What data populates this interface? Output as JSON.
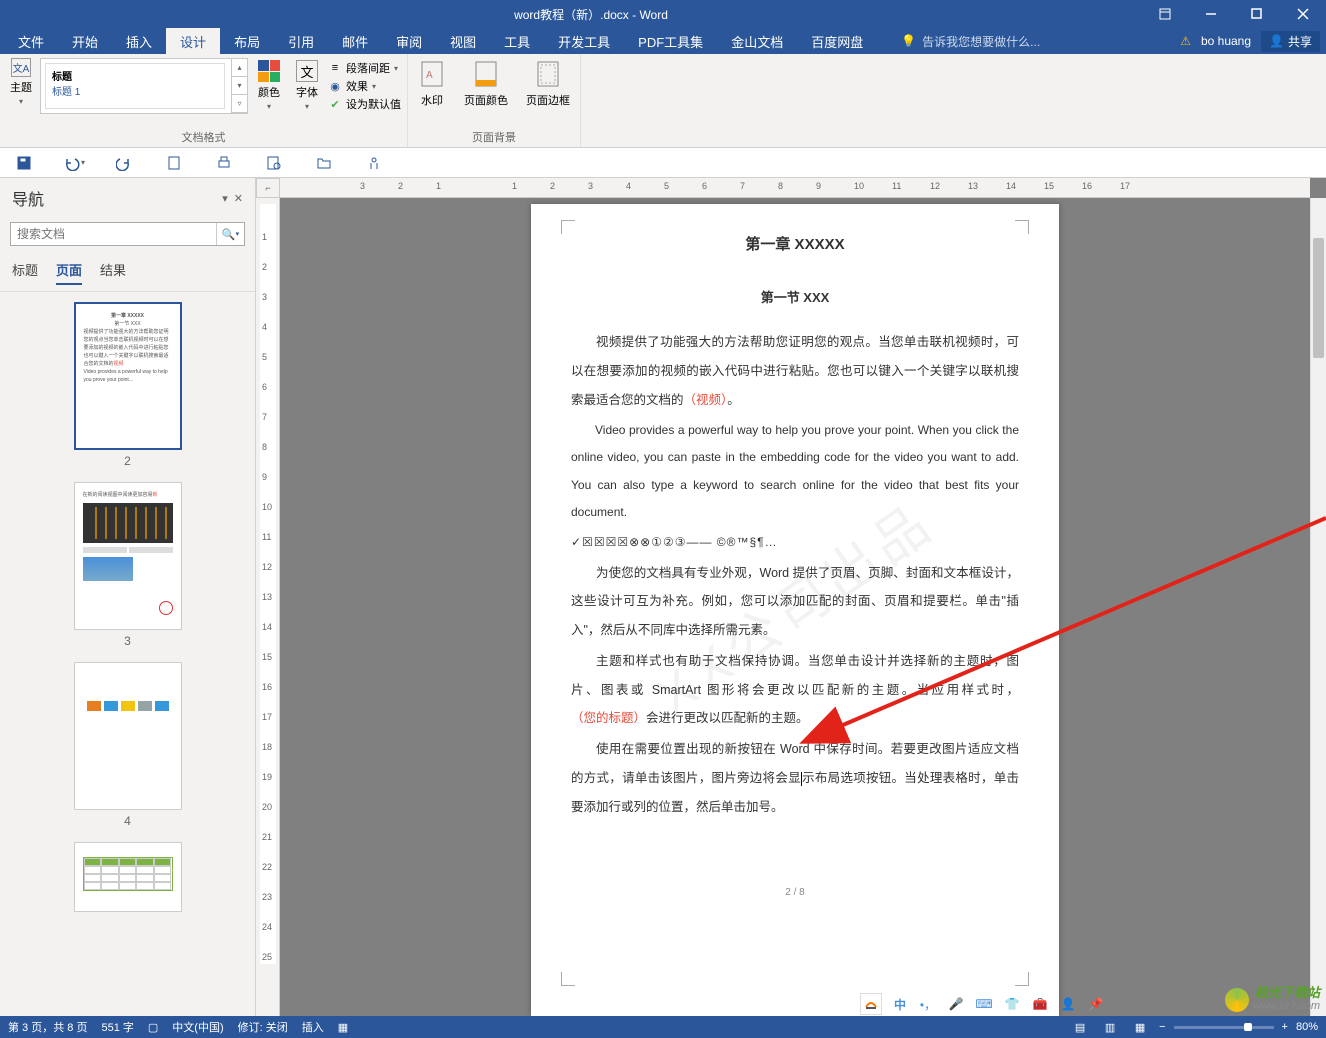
{
  "titlebar": {
    "title": "word教程（新）.docx - Word"
  },
  "account": {
    "warn_icon": "⚠",
    "name": "bo huang",
    "share": "共享"
  },
  "ribbon": {
    "tabs": [
      "文件",
      "开始",
      "插入",
      "设计",
      "布局",
      "引用",
      "邮件",
      "审阅",
      "视图",
      "工具",
      "开发工具",
      "PDF工具集",
      "金山文档",
      "百度网盘"
    ],
    "active_index": 3,
    "search_placeholder": "告诉我您想要做什么...",
    "groups": {
      "left": {
        "theme_label": "主题",
        "style_label": "标题",
        "style_sub": "标题 1",
        "format_group": "文档格式",
        "color_label": "颜色",
        "font_label": "字体",
        "opts": {
          "spacing": "段落间距",
          "effects": "效果",
          "default": "设为默认值"
        }
      },
      "pagebg": {
        "watermark": "水印",
        "pagecolor": "页面颜色",
        "pageborder": "页面边框",
        "group": "页面背景"
      }
    }
  },
  "nav": {
    "title": "导航",
    "search_placeholder": "搜索文档",
    "tabs": [
      "标题",
      "页面",
      "结果"
    ],
    "active_tab": 1,
    "thumbs": [
      "2",
      "3",
      "4"
    ],
    "active_thumb": 0
  },
  "doc": {
    "h1": "第一章  XXXXX",
    "h2": "第一节  XXX",
    "p1a": "视频提供了功能强大的方法帮助您证明您的观点。当您单击联机视频时，可以在想要添加的视频的嵌入代码中进行粘贴。您也可以键入一个关键字以联机搜索最适合您的文档的",
    "p1b": "（视频）",
    "p1c": "。",
    "p2": "Video provides a powerful way to help you prove your point. When you click the online video, you can paste in the embedding code for the video you want to add. You can also type a keyword to search online for the video that best fits your document.",
    "syms": "✓☒☒☒☒⊗⊗①②③——     ©®™§¶…",
    "p3": "为使您的文档具有专业外观，Word 提供了页眉、页脚、封面和文本框设计，这些设计可互为补充。例如，您可以添加匹配的封面、页眉和提要栏。单击\"插入\"，然后从不同库中选择所需元素。",
    "p4a": "主题和样式也有助于文档保持协调。当您单击设计并选择新的主题时，图片、图表或 SmartArt 图形将会更改以匹配新的主题。当应用样式时，",
    "p4b": "（您的标题）",
    "p4c": "会进行更改以匹配新的主题。",
    "p5": "使用在需要位置出现的新按钮在 Word 中保存时间。若要更改图片适应文档的方式，请单击该图片，图片旁边将会显示布局选项按钮。当处理表格时，单击要添加行或列的位置，然后单击加号。",
    "pagenum": "2 / 8",
    "watermark": "XX公司出品"
  },
  "status": {
    "page": "第 3 页，共 8 页",
    "words": "551 字",
    "lang": "中文(中国)",
    "track": "修订: 关闭",
    "insert": "插入",
    "zoom": "80%"
  },
  "ruler_h": [
    "3",
    "2",
    "1",
    "",
    "1",
    "2",
    "3",
    "4",
    "5",
    "6",
    "7",
    "8",
    "9",
    "10",
    "11",
    "12",
    "13",
    "14",
    "15",
    "16",
    "17"
  ],
  "ruler_v": [
    "",
    "1",
    "2",
    "3",
    "4",
    "5",
    "6",
    "7",
    "8",
    "9",
    "10",
    "11",
    "12",
    "13",
    "14",
    "15",
    "16",
    "17",
    "18",
    "19",
    "20",
    "21",
    "22",
    "23",
    "24",
    "25"
  ],
  "site": {
    "cn": "极光下载站",
    "url": "www.xz7.com"
  }
}
